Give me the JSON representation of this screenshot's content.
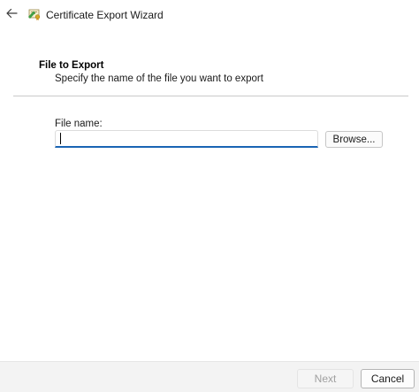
{
  "window": {
    "title": "Certificate Export Wizard",
    "icons": {
      "back": "back-arrow-icon",
      "app": "certificate-icon"
    }
  },
  "page": {
    "section_title": "File to Export",
    "section_description": "Specify the name of the file you want to export"
  },
  "form": {
    "file_name_label": "File name:",
    "file_name_value": "",
    "browse_label": "Browse..."
  },
  "footer": {
    "next_label": "Next",
    "cancel_label": "Cancel",
    "next_enabled": false
  },
  "colors": {
    "accent": "#1a64b4",
    "footer_bg": "#f3f3f3",
    "divider": "#c9c9c9"
  }
}
